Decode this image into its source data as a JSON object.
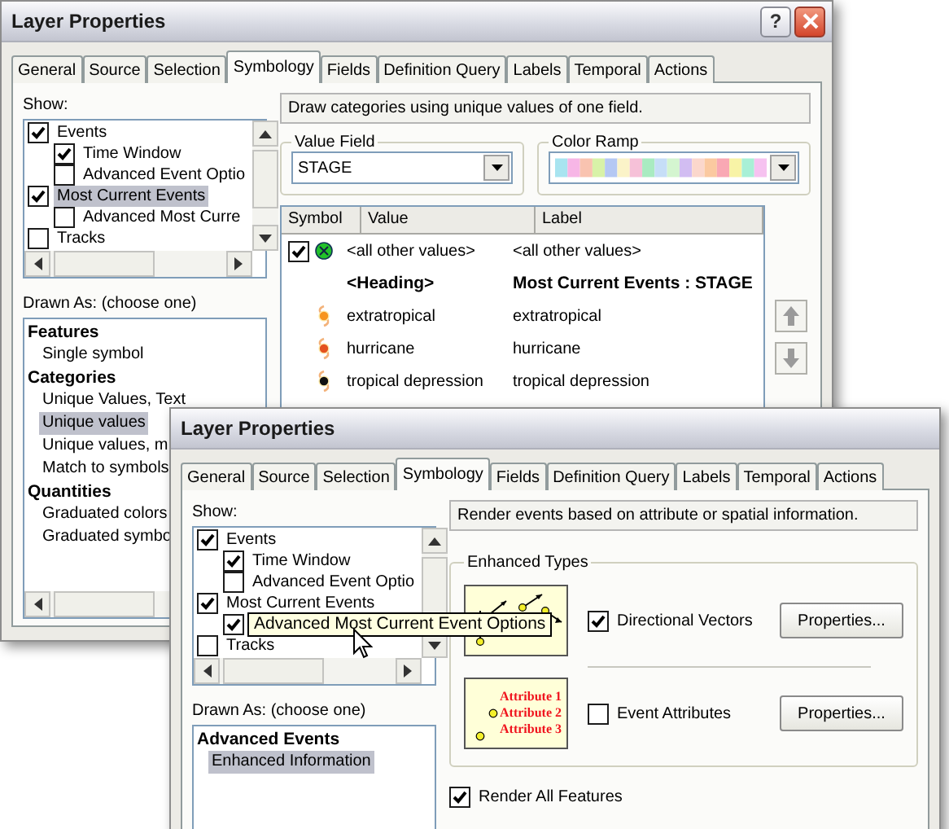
{
  "back_window": {
    "title": "Layer Properties",
    "help_button": "?",
    "tabs": [
      {
        "label": "General",
        "selected": false
      },
      {
        "label": "Source",
        "selected": false
      },
      {
        "label": "Selection",
        "selected": false
      },
      {
        "label": "Symbology",
        "selected": true
      },
      {
        "label": "Fields",
        "selected": false
      },
      {
        "label": "Definition Query",
        "selected": false
      },
      {
        "label": "Labels",
        "selected": false
      },
      {
        "label": "Temporal",
        "selected": false
      },
      {
        "label": "Actions",
        "selected": false
      }
    ],
    "show_label": "Show:",
    "show_tree": [
      {
        "label": "Events",
        "checked": true,
        "selected": false,
        "children": [
          {
            "label": "Time Window",
            "checked": true,
            "selected": false
          },
          {
            "label": "Advanced Event Optio",
            "checked": false,
            "selected": false
          }
        ]
      },
      {
        "label": "Most Current Events",
        "checked": true,
        "selected": true,
        "children": [
          {
            "label": "Advanced Most Curre",
            "checked": false,
            "selected": false
          }
        ]
      },
      {
        "label": "Tracks",
        "checked": false,
        "selected": false
      }
    ],
    "drawn_as_label": "Drawn As: (choose one)",
    "drawn_as": [
      {
        "label": "Features",
        "children": [
          {
            "label": "Single symbol",
            "selected": false
          }
        ]
      },
      {
        "label": "Categories",
        "children": [
          {
            "label": "Unique Values, Text",
            "selected": false
          },
          {
            "label": "Unique values",
            "selected": true
          },
          {
            "label": "Unique values, m",
            "selected": false
          },
          {
            "label": "Match to symbols",
            "selected": false
          }
        ]
      },
      {
        "label": "Quantities",
        "children": [
          {
            "label": "Graduated colors",
            "selected": false
          },
          {
            "label": "Graduated symbo",
            "selected": false
          }
        ]
      }
    ],
    "description": "Draw categories using unique values of one field.",
    "value_field": {
      "label": "Value Field",
      "value": "STAGE"
    },
    "color_ramp": {
      "label": "Color Ramp"
    },
    "table": {
      "columns": [
        "Symbol",
        "Value",
        "Label"
      ],
      "rows": [
        {
          "kind": "all_other",
          "checked": true,
          "color": "#22c22a",
          "value": "<all other values>",
          "label": "<all other values>"
        },
        {
          "kind": "heading",
          "value": "<Heading>",
          "label": "Most Current Events : STAGE"
        },
        {
          "kind": "symbol",
          "color": "#f7941d",
          "value": "extratropical",
          "label": "extratropical"
        },
        {
          "kind": "symbol",
          "color": "#e4521f",
          "value": "hurricane",
          "label": "hurricane"
        },
        {
          "kind": "symbol",
          "color": "#111111",
          "value": "tropical depression",
          "label": "tropical depression"
        }
      ]
    }
  },
  "front_window": {
    "title": "Layer Properties",
    "tabs": [
      {
        "label": "General",
        "selected": false
      },
      {
        "label": "Source",
        "selected": false
      },
      {
        "label": "Selection",
        "selected": false
      },
      {
        "label": "Symbology",
        "selected": true
      },
      {
        "label": "Fields",
        "selected": false
      },
      {
        "label": "Definition Query",
        "selected": false
      },
      {
        "label": "Labels",
        "selected": false
      },
      {
        "label": "Temporal",
        "selected": false
      },
      {
        "label": "Actions",
        "selected": false
      }
    ],
    "show_label": "Show:",
    "show_tree": [
      {
        "label": "Events",
        "checked": true,
        "selected": false,
        "children": [
          {
            "label": "Time Window",
            "checked": true,
            "selected": false
          },
          {
            "label": "Advanced Event Optio",
            "checked": false,
            "selected": false
          }
        ]
      },
      {
        "label": "Most Current Events",
        "checked": true,
        "selected": false,
        "children": [
          {
            "checked": true,
            "selected": false
          }
        ]
      },
      {
        "label": "Tracks",
        "checked": false,
        "selected": false
      }
    ],
    "tooltip": "Advanced Most Current Event Options",
    "drawn_as_label": "Drawn As: (choose one)",
    "drawn_as": [
      {
        "label": "Advanced Events",
        "children": [
          {
            "label": "Enhanced Information",
            "selected": true
          }
        ]
      }
    ],
    "description": "Render events based on attribute or spatial information.",
    "enhanced_types": {
      "label": "Enhanced Types",
      "options": [
        {
          "kind": "vectors",
          "label": "Directional Vectors",
          "checked": true,
          "button": "Properties..."
        },
        {
          "kind": "attributes",
          "label": "Event Attributes",
          "checked": false,
          "button": "Properties...",
          "preview_texts": [
            "Attribute 1",
            "Attribute 2",
            "Attribute 3"
          ]
        }
      ]
    },
    "render_all": {
      "label": "Render All Features",
      "checked": true
    }
  }
}
